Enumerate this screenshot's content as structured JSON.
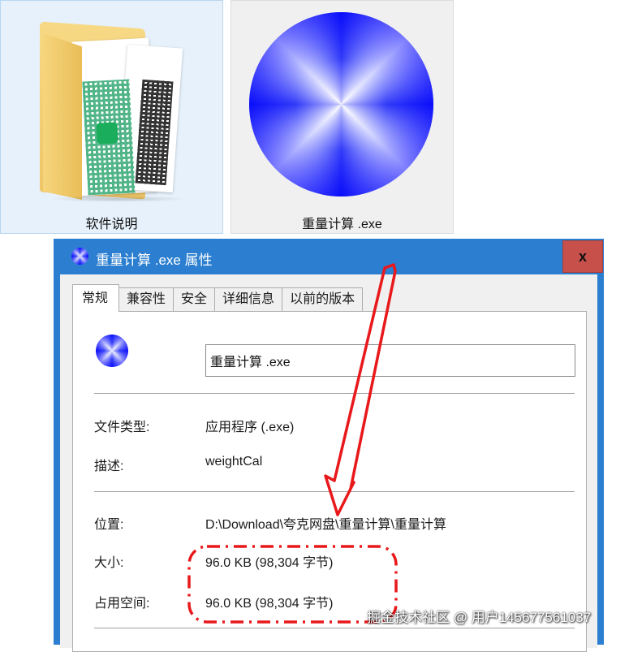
{
  "explorer": {
    "items": [
      {
        "label": "软件说明",
        "icon": "folder-icon",
        "selected": true
      },
      {
        "label": "重量计算 .exe",
        "icon": "exe-orb-icon",
        "selected": false
      }
    ]
  },
  "dialog": {
    "title": "重量计算 .exe 属性",
    "close_label": "x",
    "tabs": [
      {
        "label": "常规",
        "active": true
      },
      {
        "label": "兼容性",
        "active": false
      },
      {
        "label": "安全",
        "active": false
      },
      {
        "label": "详细信息",
        "active": false
      },
      {
        "label": "以前的版本",
        "active": false
      }
    ],
    "file_name": "重量计算 .exe",
    "properties": {
      "type_label": "文件类型:",
      "type_value": "应用程序 (.exe)",
      "desc_label": "描述:",
      "desc_value": "weightCal",
      "location_label": "位置:",
      "location_value": "D:\\Download\\夸克网盘\\重量计算\\重量计算",
      "size_label": "大小:",
      "size_value": "96.0 KB (98,304 字节)",
      "disk_label": "占用空间:",
      "disk_value": "96.0 KB (98,304 字节)"
    }
  },
  "watermark": "掘金技术社区 @ 用户145677561037",
  "colors": {
    "dialog_frame": "#2c7fd0",
    "close_button": "#c7504a",
    "annotation": "#e8181b",
    "orb": "#0a12f5"
  }
}
